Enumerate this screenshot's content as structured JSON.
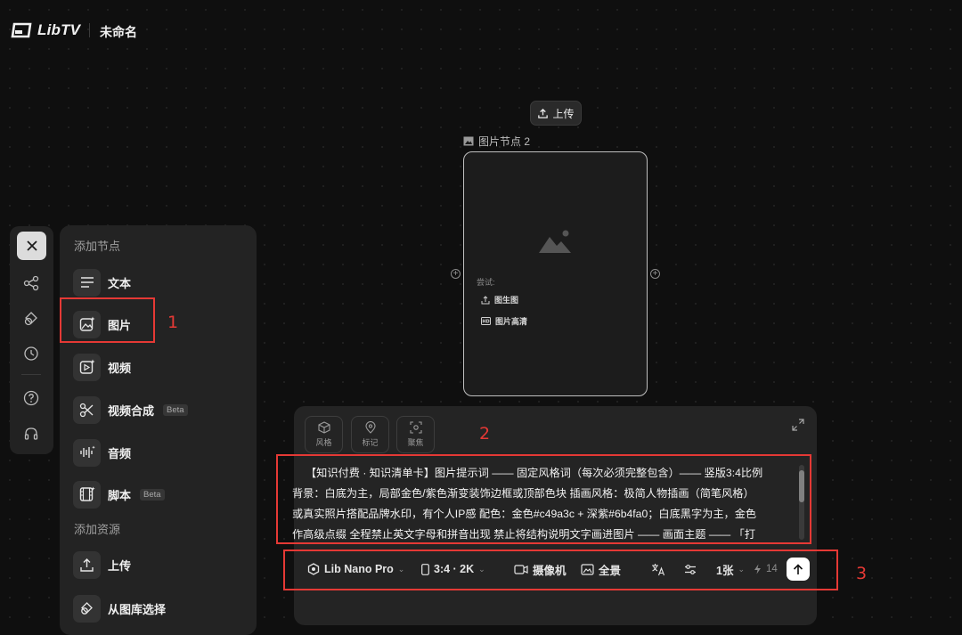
{
  "app": {
    "logo_text": "LibTV",
    "title": "未命名"
  },
  "canvas": {
    "upload_label": "上传",
    "node": {
      "label": "图片节点 2",
      "try_label": "尝试:",
      "actions": [
        "图生图",
        "图片高清"
      ]
    }
  },
  "rail": {
    "icons": [
      "close-icon",
      "workflow-icon",
      "shapes-icon",
      "history-icon",
      "help-icon",
      "support-headset-icon"
    ]
  },
  "panel": {
    "section_nodes": "添加节点",
    "nodes": [
      {
        "label": "文本",
        "icon": "text-lines-icon"
      },
      {
        "label": "图片",
        "icon": "image-sparkle-icon"
      },
      {
        "label": "视频",
        "icon": "video-sparkle-icon"
      },
      {
        "label": "视频合成",
        "icon": "scissors-icon",
        "badge": "Beta"
      },
      {
        "label": "音频",
        "icon": "audio-wave-icon"
      },
      {
        "label": "脚本",
        "icon": "film-script-icon",
        "badge": "Beta"
      }
    ],
    "section_assets": "添加资源",
    "assets": [
      {
        "label": "上传",
        "icon": "upload-icon"
      },
      {
        "label": "从图库选择",
        "icon": "gallery-icon"
      }
    ]
  },
  "prompt": {
    "tools": [
      {
        "label": "风格",
        "icon": "cube-icon"
      },
      {
        "label": "标记",
        "icon": "pin-icon"
      },
      {
        "label": "聚焦",
        "icon": "focus-icon"
      }
    ],
    "text_lines": [
      "【知识付费 · 知识清单卡】图片提示词 —— 固定风格词（每次必须完整包含）—— 竖版3:4比例",
      "背景：白底为主，局部金色/紫色渐变装饰边框或顶部色块 插画风格：极简人物插画（简笔风格）",
      "或真实照片搭配品牌水印，有个人IP感 配色：金色#c49a3c + 深紫#6b4fa0；白底黑字为主，金色",
      "作高级点缀 全程禁止英文字母和拼音出现 禁止将结构说明文字画进图片 —— 画面主题 —— 「打"
    ],
    "model": "Lib Nano Pro",
    "ratio_quality": "3:4 · 2K",
    "camera_label": "摄像机",
    "panorama_label": "全景",
    "count_label": "1张",
    "credits": "14"
  },
  "annotations": [
    "1",
    "2",
    "3"
  ]
}
